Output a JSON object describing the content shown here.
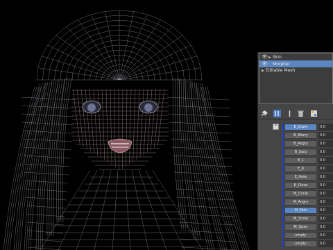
{
  "viewport": {
    "name": "3d-viewport-wireframe-head"
  },
  "modifier_stack": {
    "items": [
      {
        "label": "Skin",
        "visible": true,
        "expandable": true,
        "selected": false
      },
      {
        "label": "Morpher",
        "visible": true,
        "expandable": false,
        "selected": true
      },
      {
        "label": "Editable Mesh",
        "visible": false,
        "expandable": true,
        "selected": false
      }
    ]
  },
  "toolbar": {
    "icons": [
      "pin-stack-icon",
      "show-end-result-icon",
      "make-unique-icon",
      "remove-modifier-icon",
      "configure-modifier-sets-icon"
    ]
  },
  "channels": {
    "scroll_up_label": "^",
    "items": [
      {
        "name": "B_Down",
        "value": "0.0",
        "active": true
      },
      {
        "name": "B_Worry",
        "value": "0.0",
        "active": false
      },
      {
        "name": "B_Angry",
        "value": "0.0",
        "active": false
      },
      {
        "name": "B_Surp",
        "value": "0.0",
        "active": false
      },
      {
        "name": "E_L",
        "value": "0.0",
        "active": false
      },
      {
        "name": "E_R",
        "value": "0.0",
        "active": false
      },
      {
        "name": "E_Hate",
        "value": "0.0",
        "active": false
      },
      {
        "name": "E_Close",
        "value": "0.0",
        "active": false
      },
      {
        "name": "M_Circle",
        "value": "0.0",
        "active": false
      },
      {
        "name": "M_Angry",
        "value": "0.0",
        "active": false
      },
      {
        "name": "M_Pain",
        "value": "0.0",
        "active": true
      },
      {
        "name": "M_Smile",
        "value": "0.0",
        "active": false
      },
      {
        "name": "M_Open",
        "value": "0.0",
        "active": false
      },
      {
        "name": "- empty -",
        "value": "0.0",
        "active": false
      },
      {
        "name": "- empty -",
        "value": "0.0",
        "active": false
      }
    ]
  },
  "colors": {
    "selection": "#5b86c2",
    "channel_bar": "#1f3fcf",
    "panel_bg": "#454545"
  }
}
